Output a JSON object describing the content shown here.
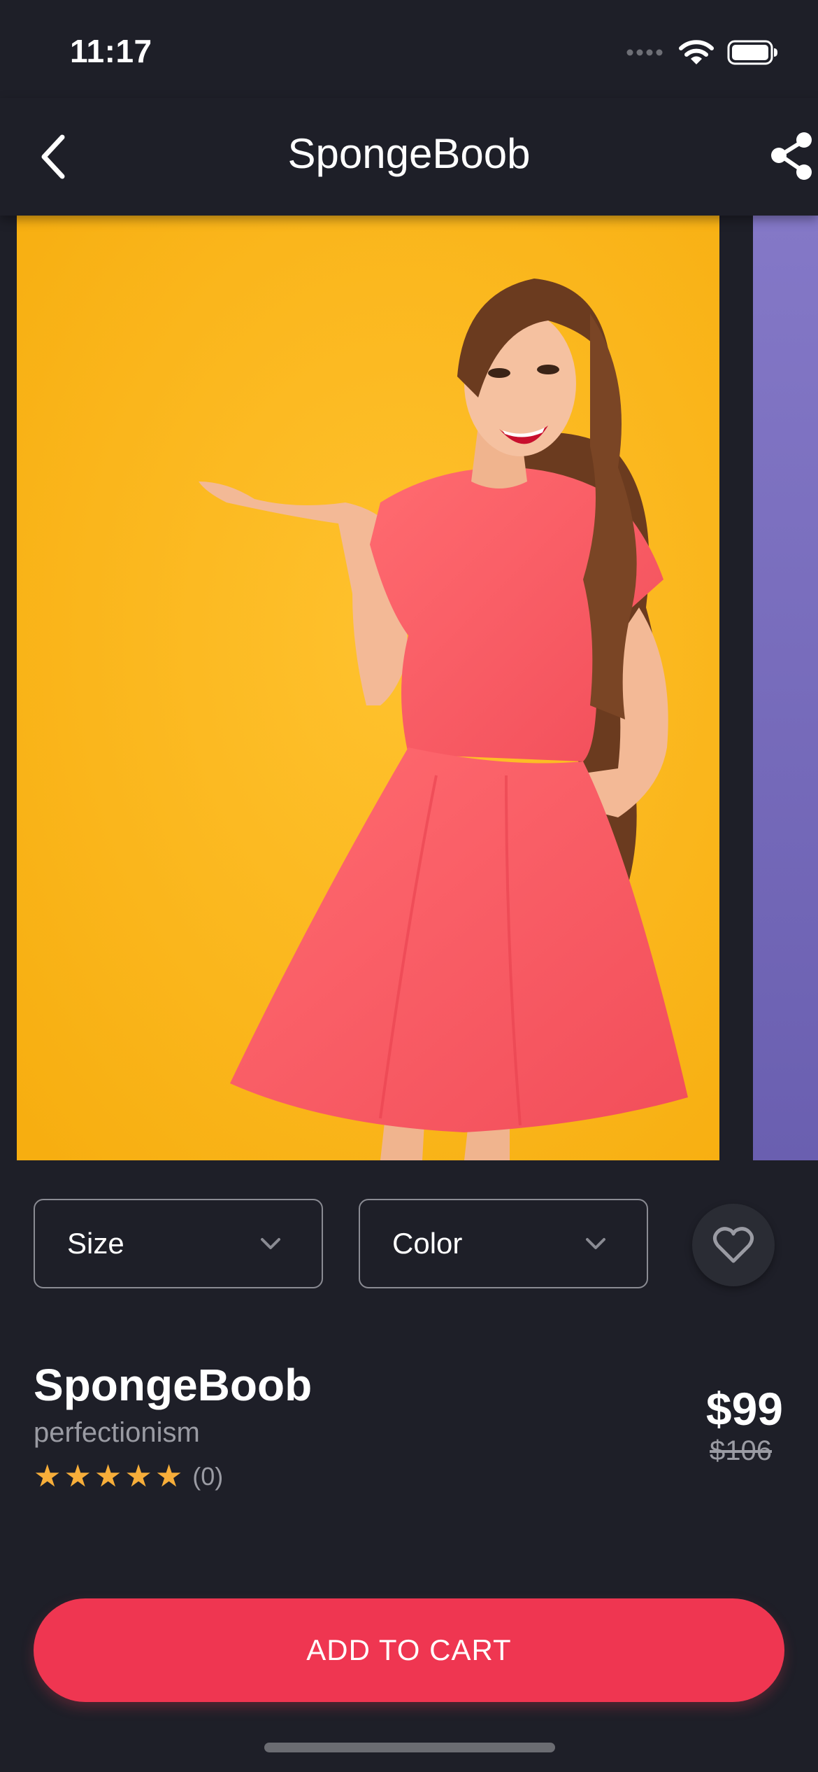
{
  "status_bar": {
    "time": "11:17"
  },
  "header": {
    "title": "SpongeBoob"
  },
  "selectors": {
    "size_label": "Size",
    "color_label": "Color"
  },
  "product": {
    "name": "SpongeBoob",
    "brand": "perfectionism",
    "rating_stars": 5,
    "rating_count": "(0)",
    "price": "$99",
    "old_price": "$106"
  },
  "cart": {
    "button_label": "ADD TO CART"
  },
  "icons": {
    "back": "chevron-left-icon",
    "share": "share-icon",
    "favorite": "heart-outline-icon",
    "dropdown": "chevron-down-icon"
  },
  "colors": {
    "background": "#1e1f28",
    "accent": "#ef3651",
    "star": "#f7ae3a",
    "muted_text": "#9a9ba3"
  }
}
